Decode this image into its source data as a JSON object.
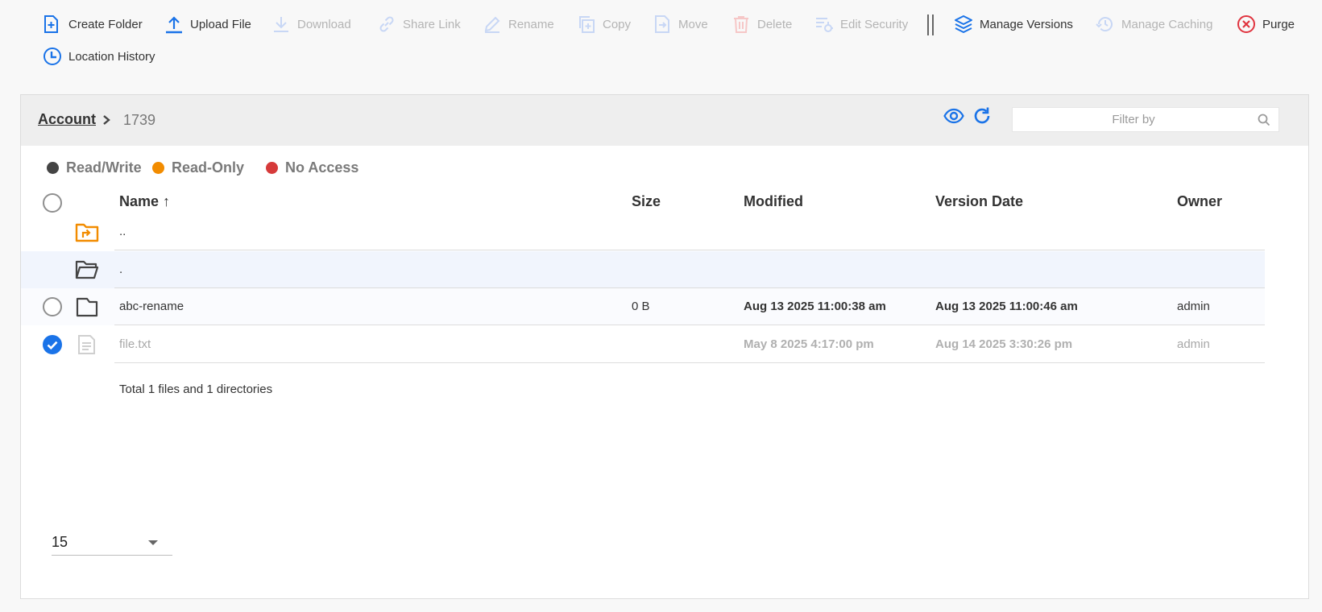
{
  "toolbar": {
    "create_folder": "Create Folder",
    "upload_file": "Upload File",
    "download": "Download",
    "share_link": "Share Link",
    "rename": "Rename",
    "copy": "Copy",
    "move": "Move",
    "delete": "Delete",
    "edit_security": "Edit Security",
    "manage_versions": "Manage Versions",
    "manage_caching": "Manage Caching",
    "purge": "Purge",
    "location_history": "Location History"
  },
  "breadcrumb": {
    "root": "Account",
    "current": "1739"
  },
  "filter": {
    "placeholder": "Filter by"
  },
  "legend": {
    "read_write": "Read/Write",
    "read_only": "Read-Only",
    "no_access": "No Access"
  },
  "colors": {
    "accent": "#1a73e8",
    "read_write": "#444444",
    "read_only": "#f28c00",
    "no_access": "#d63a3a",
    "purge": "#e0343f",
    "selected_row": "#f1f5fd"
  },
  "table": {
    "columns": {
      "name": "Name",
      "sort_indicator": "↑",
      "size": "Size",
      "modified": "Modified",
      "version_date": "Version Date",
      "owner": "Owner"
    },
    "rows": [
      {
        "name": "..",
        "size": "",
        "modified": "",
        "version_date": "",
        "owner": "",
        "icon": "parent-folder-icon"
      },
      {
        "name": ".",
        "size": "",
        "modified": "",
        "version_date": "",
        "owner": "",
        "icon": "open-folder-icon"
      },
      {
        "name": "abc-rename",
        "size": "0 B",
        "modified": "Aug 13 2025 11:00:38 am",
        "version_date": "Aug 13 2025 11:00:46 am",
        "owner": "admin",
        "icon": "folder-icon"
      },
      {
        "name": "file.txt",
        "size": "",
        "modified": "May 8 2025 4:17:00 pm",
        "version_date": "Aug 14 2025 3:30:26 pm",
        "owner": "admin",
        "icon": "file-icon",
        "selected": true
      }
    ],
    "total": "Total 1 files and 1 directories"
  },
  "pagination": {
    "page_size": "15"
  }
}
